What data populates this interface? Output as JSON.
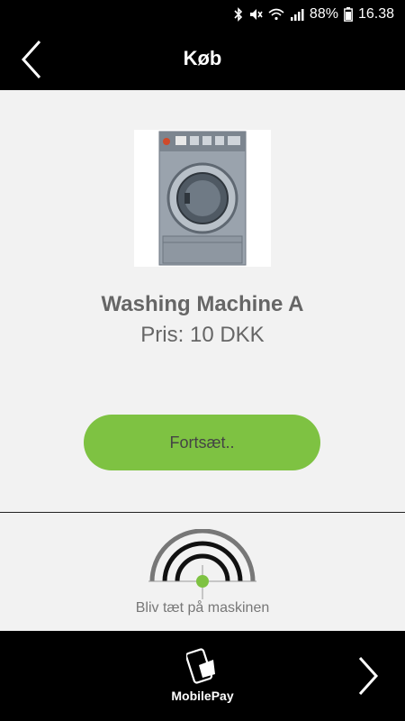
{
  "status_bar": {
    "battery": "88%",
    "time": "16.38",
    "icons": [
      "bluetooth-icon",
      "mute-icon",
      "wifi-icon",
      "signal-icon",
      "battery-icon"
    ]
  },
  "header": {
    "title": "Køb",
    "back_icon": "chevron-left-icon"
  },
  "product": {
    "image_icon": "washing-machine-image",
    "name": "Washing Machine A",
    "price": "Pris: 10 DKK"
  },
  "actions": {
    "continue_label": "Fortsæt.."
  },
  "proximity": {
    "icon": "proximity-signal-icon",
    "hint": "Bliv tæt på maskinen",
    "accent_color": "#7ec242"
  },
  "footer": {
    "mobilepay_label": "MobilePay",
    "mobilepay_icon": "mobilepay-icon",
    "next_icon": "chevron-right-icon"
  },
  "colors": {
    "bar_background": "#000000",
    "page_background": "#f2f2f2",
    "button_green": "#7ec242",
    "text_gray": "#666666"
  }
}
